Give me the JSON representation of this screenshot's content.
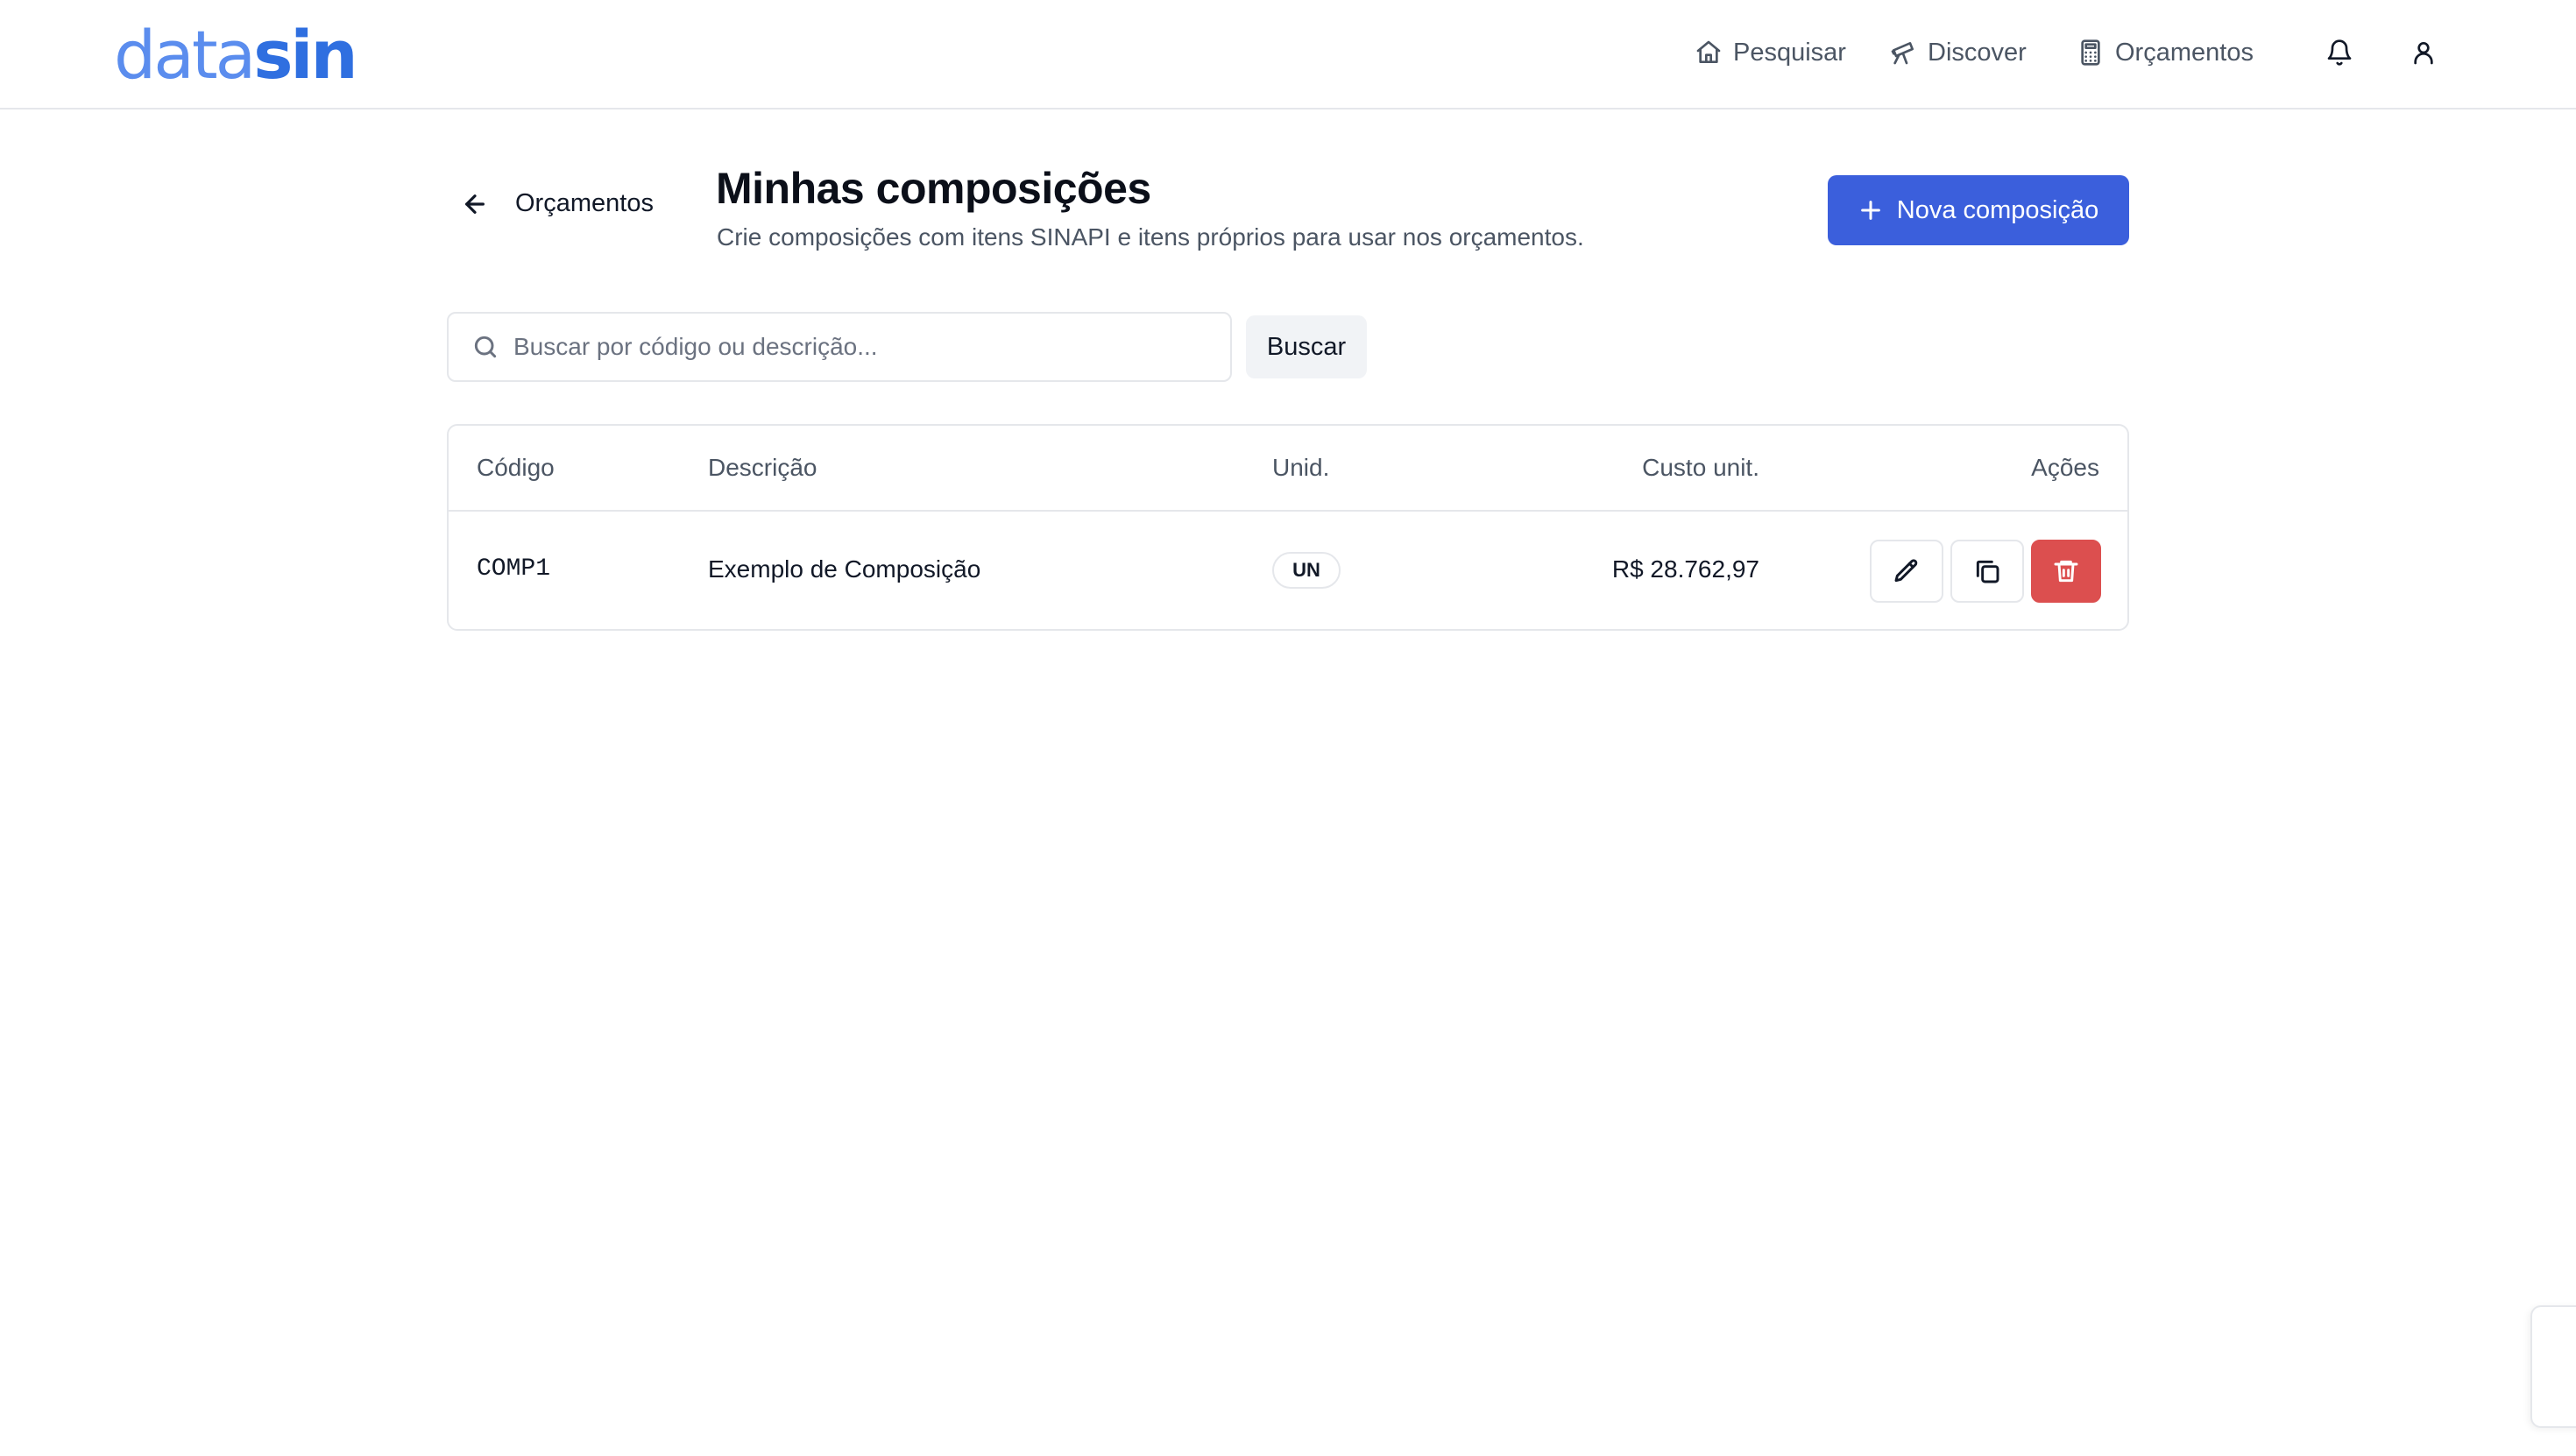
{
  "header": {
    "logo": {
      "part1": "data",
      "part2": "sin"
    },
    "nav": [
      {
        "label": "Pesquisar",
        "icon": "home-icon"
      },
      {
        "label": "Discover",
        "icon": "telescope-icon"
      },
      {
        "label": "Orçamentos",
        "icon": "calculator-icon"
      }
    ],
    "icons": [
      "bell-icon",
      "user-icon"
    ]
  },
  "page": {
    "back_label": "Orçamentos",
    "title": "Minhas composições",
    "subtitle": "Crie composições com itens SINAPI e itens próprios para usar nos orçamentos.",
    "new_button_label": "Nova composição"
  },
  "search": {
    "placeholder": "Buscar por código ou descrição...",
    "value": "",
    "button_label": "Buscar"
  },
  "table": {
    "columns": [
      "Código",
      "Descrição",
      "Unid.",
      "Custo unit.",
      "Ações"
    ],
    "rows": [
      {
        "code": "COMP1",
        "description": "Exemplo de Composição",
        "unit": "UN",
        "unit_cost": "R$ 28.762,97",
        "actions": [
          "pencil-icon",
          "copy-icon",
          "trash-icon"
        ]
      }
    ]
  },
  "colors": {
    "primary": "#3b5fdc",
    "logo_light": "#5b8dee",
    "logo_dark": "#2f6fe0",
    "danger": "#dc4f4f",
    "border": "#e5e7eb"
  }
}
